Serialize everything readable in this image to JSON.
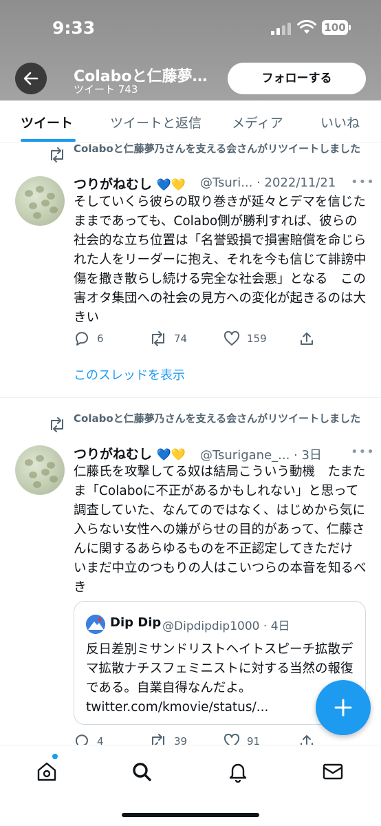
{
  "status_bar": {
    "time": "9:33",
    "battery": "100"
  },
  "header": {
    "account_name": "Colaboと仁藤夢…",
    "tweet_count": "ツイート 743",
    "follow_label": "フォローする"
  },
  "tabs": [
    {
      "label": "ツイート",
      "active": true
    },
    {
      "label": "ツイートと返信",
      "active": false
    },
    {
      "label": "メディア",
      "active": false
    },
    {
      "label": "いいね",
      "active": false
    }
  ],
  "tweets": [
    {
      "retweet_note": "Colaboと仁藤夢乃さんを支える会さんがリツイートしました",
      "name": "つりがねむし",
      "hearts": "💙💛",
      "handle_date": "@Tsuri... · 2022/11/21",
      "more": "•••",
      "text": "そしていくら彼らの取り巻きが延々とデマを信じたままであっても、Colabo側が勝利すれば、彼らの社会的な立ち位置は「名誉毀損で損害賠償を命じられた人をリーダーに抱え、それを今も信じて誹謗中傷を撒き散らし続ける完全な社会悪」となる　この害オタ集団への社会の見方への変化が起きるのは大きい",
      "replies": "6",
      "retweets": "74",
      "likes": "159",
      "thread_link": "このスレッドを表示"
    },
    {
      "retweet_note": "Colaboと仁藤夢乃さんを支える会さんがリツイートしました",
      "name": "つりがねむし",
      "hearts": "💙💛",
      "handle_date": "@Tsurigane_... · 3日",
      "more": "•••",
      "text": "仁藤氏を攻撃してる奴は結局こういう動機　たまたま「Colaboに不正があるかもしれない」と思って調査していた、なんてのではなく、はじめから気に入らない女性への嫌がらせの目的があって、仁藤さんに関するあらゆるものを不正認定してきただけ　いまだ中立のつもりの人はこいつらの本音を知るべき",
      "quote": {
        "name": "Dip Dip",
        "handle_date": "@Dipdipdip1000 · 4日",
        "text": "反日差別ミサンドリストヘイトスピーチ拡散デマ拡散ナチスフェミニストに対する当然の報復である。自業自得なんだよ。 twitter.com/kmovie/status/..."
      },
      "replies": "4",
      "retweets": "39",
      "likes": "91"
    }
  ],
  "colors": {
    "accent": "#1d9bf0",
    "text": "#0f1419",
    "secondary": "#536471"
  }
}
